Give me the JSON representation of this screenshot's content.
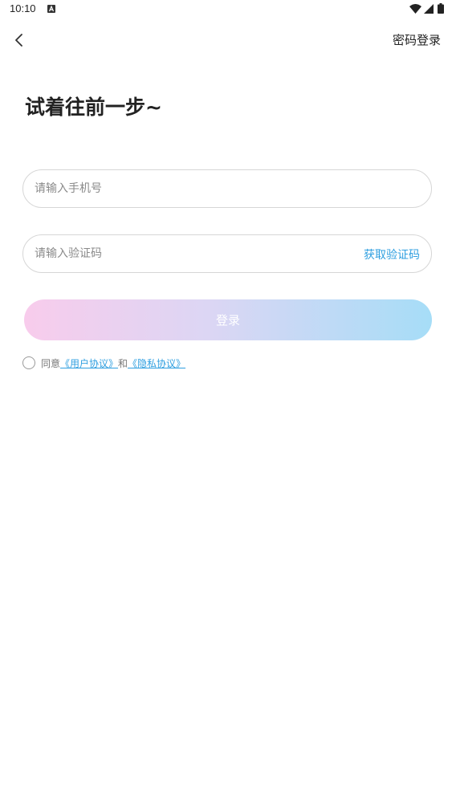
{
  "status_bar": {
    "time": "10:10",
    "notification_icon": "a-box-icon",
    "wifi_icon": "wifi-icon",
    "signal_icon": "signal-icon",
    "battery_icon": "battery-icon"
  },
  "header": {
    "back_icon": "chevron-left-icon",
    "password_login": "密码登录"
  },
  "title": "试着往前一步~",
  "form": {
    "phone_placeholder": "请输入手机号",
    "phone_value": "",
    "code_placeholder": "请输入验证码",
    "code_value": "",
    "get_code": "获取验证码",
    "login_button": "登录"
  },
  "agreement": {
    "prefix": "同意",
    "user_agreement": "《用户协议》",
    "connector": "和",
    "privacy_agreement": "《隐私协议》",
    "checked": false
  },
  "colors": {
    "link": "#2f9fe0",
    "gradient_start": "#f8ccec",
    "gradient_end": "#a6ddf7"
  }
}
